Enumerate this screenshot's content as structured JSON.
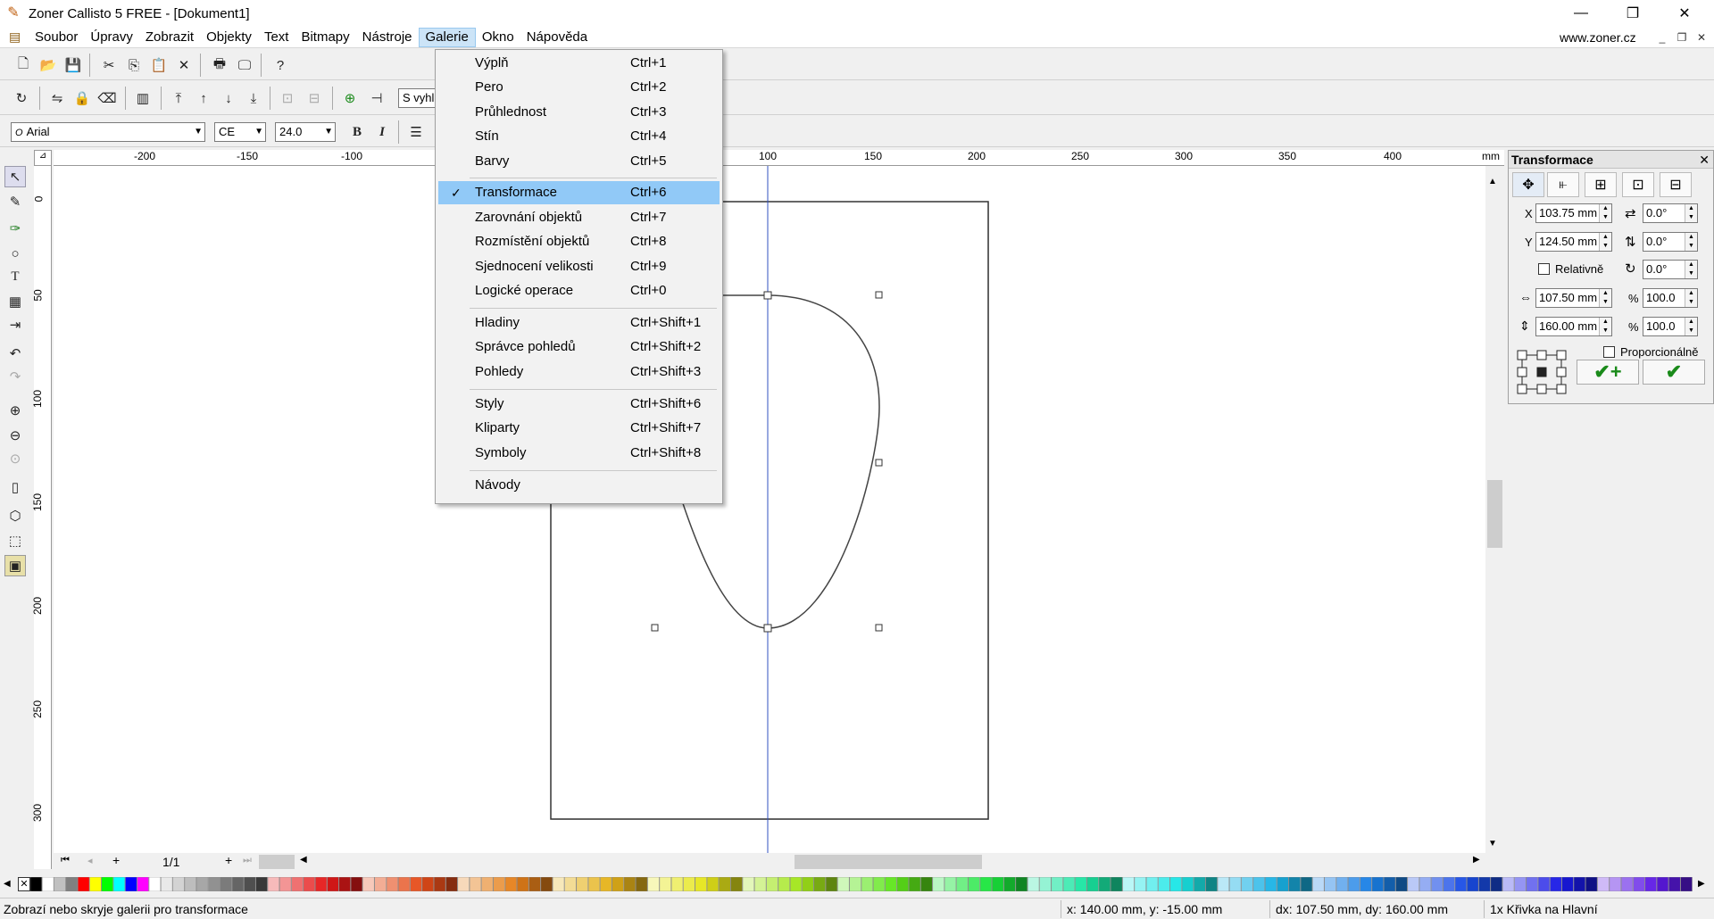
{
  "window": {
    "title": "Zoner Callisto 5 FREE - [Dokument1]"
  },
  "menubar": {
    "items": [
      "Soubor",
      "Úpravy",
      "Zobrazit",
      "Objekty",
      "Text",
      "Bitmapy",
      "Nástroje",
      "Galerie",
      "Okno",
      "Nápověda"
    ],
    "active": "Galerie",
    "right_link": "www.zoner.cz"
  },
  "toolbar": {
    "font_name": "Arial",
    "charset": "CE",
    "font_size": "24.0",
    "bold": "B",
    "italic": "I",
    "snap_combo": "S vyhl"
  },
  "galerie_menu": {
    "items": [
      {
        "label": "Výplň",
        "shortcut": "Ctrl+1"
      },
      {
        "label": "Pero",
        "shortcut": "Ctrl+2"
      },
      {
        "label": "Průhlednost",
        "shortcut": "Ctrl+3"
      },
      {
        "label": "Stín",
        "shortcut": "Ctrl+4"
      },
      {
        "label": "Barvy",
        "shortcut": "Ctrl+5"
      },
      {
        "label": "Transformace",
        "shortcut": "Ctrl+6",
        "checked": true,
        "highlighted": true
      },
      {
        "label": "Zarovnání objektů",
        "shortcut": "Ctrl+7"
      },
      {
        "label": "Rozmístění objektů",
        "shortcut": "Ctrl+8"
      },
      {
        "label": "Sjednocení velikosti",
        "shortcut": "Ctrl+9"
      },
      {
        "label": "Logické operace",
        "shortcut": "Ctrl+0"
      },
      {
        "label": "Hladiny",
        "shortcut": "Ctrl+Shift+1"
      },
      {
        "label": "Správce pohledů",
        "shortcut": "Ctrl+Shift+2"
      },
      {
        "label": "Pohledy",
        "shortcut": "Ctrl+Shift+3"
      },
      {
        "label": "Styly",
        "shortcut": "Ctrl+Shift+6"
      },
      {
        "label": "Kliparty",
        "shortcut": "Ctrl+Shift+7"
      },
      {
        "label": "Symboly",
        "shortcut": "Ctrl+Shift+8"
      },
      {
        "label": "Návody",
        "shortcut": ""
      }
    ]
  },
  "ruler": {
    "top_labels": [
      "-200",
      "-150",
      "-100",
      "100",
      "150",
      "200",
      "250",
      "300",
      "350",
      "400"
    ],
    "unit": "mm",
    "left_labels": [
      "0",
      "50",
      "100",
      "150",
      "200",
      "250",
      "300"
    ]
  },
  "transform_panel": {
    "title": "Transformace",
    "x_label": "X",
    "x_value": "103.75 mm",
    "y_label": "Y",
    "y_value": "124.50 mm",
    "skew_h": "0.0°",
    "skew_v": "0.0°",
    "rotate": "0.0°",
    "relative_label": "Relativně",
    "width_value": "107.50 mm",
    "height_value": "160.00 mm",
    "pct_label": "%",
    "width_pct": "100.0",
    "height_pct": "100.0",
    "proportional_label": "Proporcionálně"
  },
  "page_nav": {
    "page": "1/1"
  },
  "status": {
    "hint": "Zobrazí nebo skryje galerii pro transformace",
    "coords": "x: 140.00 mm, y: -15.00 mm",
    "delta": "dx: 107.50 mm, dy: 160.00 mm",
    "selection": "1x Křivka na Hlavní"
  },
  "palette_colors": [
    "#000000",
    "#ffffff",
    "#808080",
    "#c0c0c0",
    "#ff0000",
    "#ffff00",
    "#00ff00",
    "#00ffff",
    "#0000ff",
    "#ff00ff"
  ]
}
